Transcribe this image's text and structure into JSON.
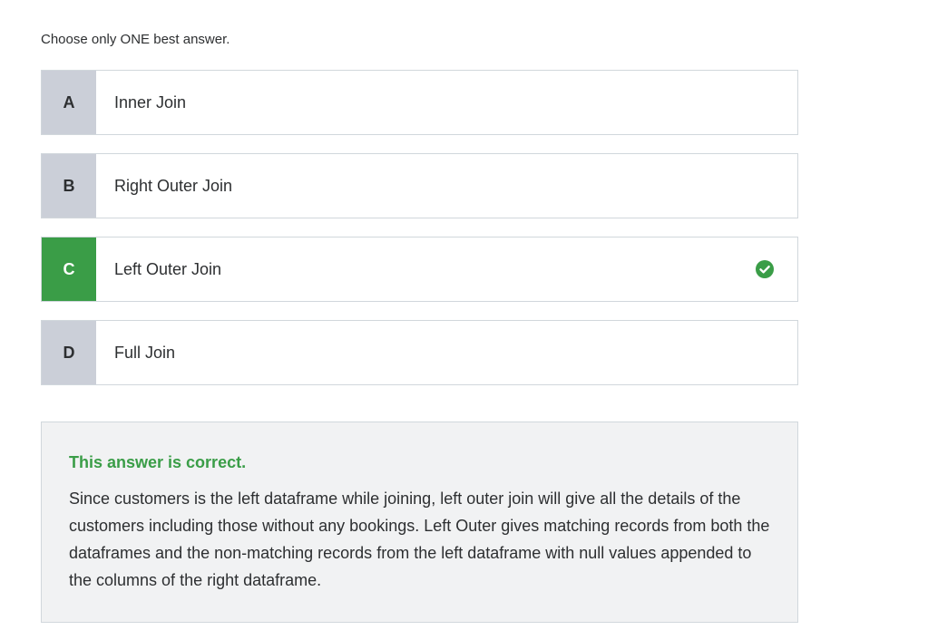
{
  "instruction": "Choose only ONE best answer.",
  "options": [
    {
      "letter": "A",
      "text": "Inner Join",
      "correct": false
    },
    {
      "letter": "B",
      "text": "Right Outer Join",
      "correct": false
    },
    {
      "letter": "C",
      "text": "Left Outer Join",
      "correct": true
    },
    {
      "letter": "D",
      "text": "Full Join",
      "correct": false
    }
  ],
  "selected_icon": "check-circle-icon",
  "feedback": {
    "title": "This answer is correct.",
    "body": "Since customers is the left dataframe while joining, left outer join will give all the details of the customers including those without any bookings. Left Outer gives matching records from both the dataframes and the non-matching records from the left dataframe with null values appended to the columns of the right dataframe."
  },
  "colors": {
    "correct": "#3a9d47",
    "letter_bg": "#cbcfd8",
    "feedback_bg": "#f1f2f3",
    "border": "#d1d7dc"
  }
}
